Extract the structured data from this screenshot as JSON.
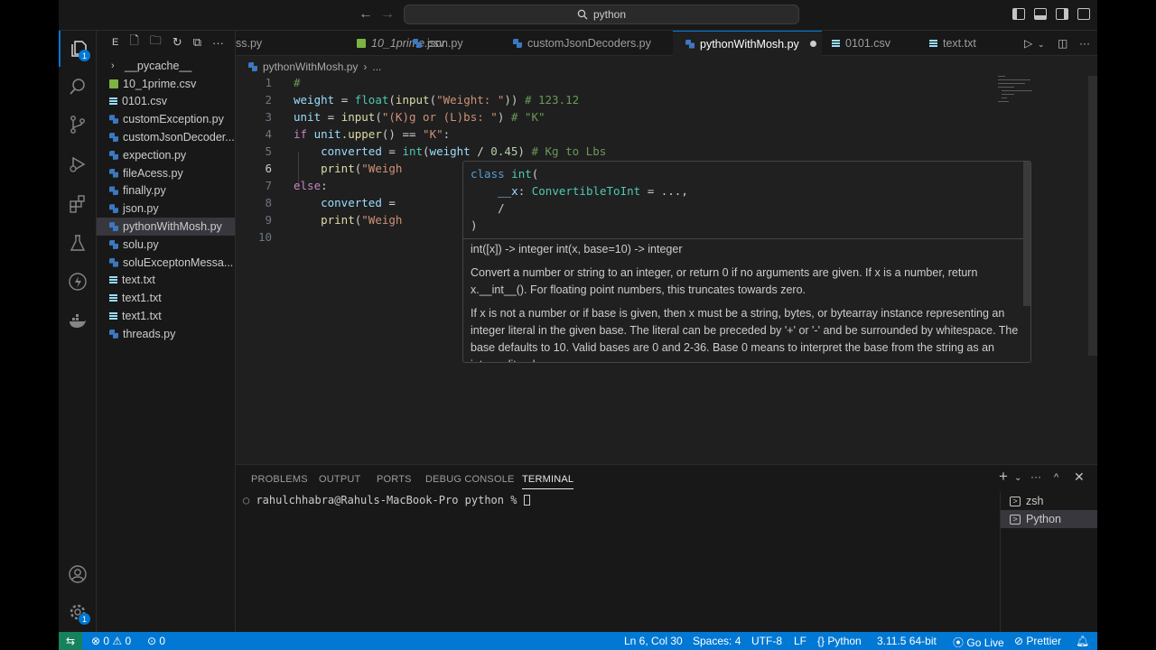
{
  "titlebar": {
    "search": "python"
  },
  "activity": {
    "explorer_badge": "1",
    "settings_badge": "1"
  },
  "sidebar": {
    "header": "E",
    "items": [
      {
        "label": "__pycache__",
        "kind": "folder"
      },
      {
        "label": "10_1prime.csv",
        "kind": "csv"
      },
      {
        "label": "0101.csv",
        "kind": "txt"
      },
      {
        "label": "customException.py",
        "kind": "py"
      },
      {
        "label": "customJsonDecoder...",
        "kind": "py"
      },
      {
        "label": "expection.py",
        "kind": "py"
      },
      {
        "label": "fileAcess.py",
        "kind": "py"
      },
      {
        "label": "finally.py",
        "kind": "py"
      },
      {
        "label": "json.py",
        "kind": "py"
      },
      {
        "label": "pythonWithMosh.py",
        "kind": "py"
      },
      {
        "label": "solu.py",
        "kind": "py"
      },
      {
        "label": "soluExceptonMessa...",
        "kind": "py"
      },
      {
        "label": "text.txt",
        "kind": "txt"
      },
      {
        "label": "text1.txt",
        "kind": "txt"
      },
      {
        "label": "text1.txt",
        "kind": "txt"
      },
      {
        "label": "threads.py",
        "kind": "py"
      }
    ]
  },
  "tabs": [
    {
      "label": "ss.py"
    },
    {
      "label": "10_1prime.csv"
    },
    {
      "label": "json.py"
    },
    {
      "label": "customJsonDecoders.py"
    },
    {
      "label": "pythonWithMosh.py"
    },
    {
      "label": "0101.csv"
    },
    {
      "label": "text.txt"
    }
  ],
  "breadcrumb": {
    "file": "pythonWithMosh.py",
    "more": "..."
  },
  "editor": {
    "line_numbers": [
      "1",
      "2",
      "3",
      "4",
      "5",
      "6",
      "7",
      "8",
      "9",
      "10"
    ],
    "lines": [
      "#",
      "weight = float(input(\"Weight: \")) # 123.12",
      "unit = input(\"(K)g or (L)bs: \") # \"K\"",
      "if unit.upper() == \"K\":",
      "    converted = int(weight / 0.45) # Kg to Lbs",
      "    print(\"Weigh",
      "else:",
      "    converted = ",
      "    print(\"Weigh",
      ""
    ]
  },
  "hover": {
    "signature": [
      "class int(",
      "    __x: ConvertibleToInt = ...,",
      "    /",
      ")"
    ],
    "doc": [
      "int([x]) -> integer int(x, base=10) -> integer",
      "Convert a number or string to an integer, or return 0 if no arguments are given. If x is a number, return x.__int__(). For floating point numbers, this truncates towards zero.",
      "If x is not a number or if base is given, then x must be a string, bytes, or bytearray instance representing an integer literal in the given base. The literal can be preceded by '+' or '-' and be surrounded by whitespace. The base defaults to 10. Valid bases are 0 and 2-36. Base 0 means to interpret the base from the string as an integer literal."
    ]
  },
  "panel": {
    "tabs": [
      "PROBLEMS",
      "OUTPUT",
      "PORTS",
      "DEBUG CONSOLE",
      "TERMINAL"
    ],
    "prompt": "rahulchhabra@Rahuls-MacBook-Pro python % ",
    "terminals": [
      "zsh",
      "Python"
    ]
  },
  "status": {
    "errors": "0",
    "warnings": "0",
    "ports": "0",
    "position": "Ln 6, Col 30",
    "spaces": "Spaces: 4",
    "encoding": "UTF-8",
    "eol": "LF",
    "language": "Python",
    "interpreter": "3.11.5 64-bit",
    "golive": "Go Live",
    "prettier": "Prettier"
  },
  "colors": {
    "accent": "#0078d4",
    "remote": "#16825d"
  }
}
